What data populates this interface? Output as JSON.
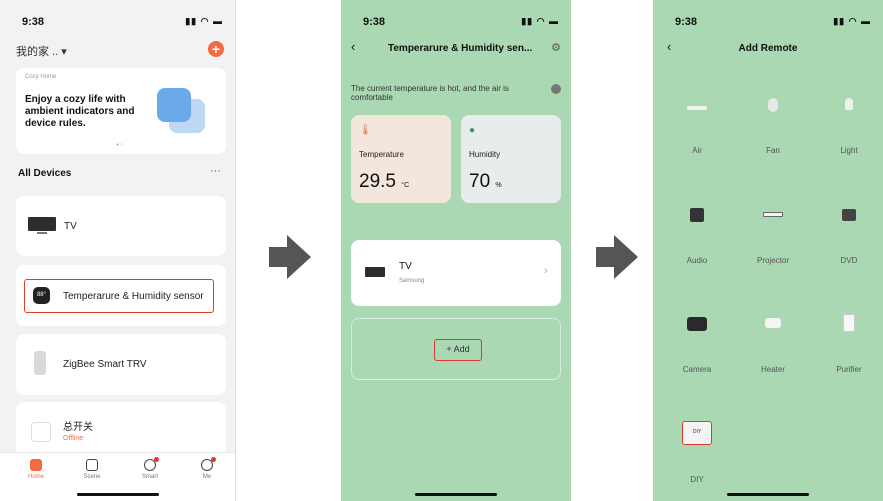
{
  "arrows": {
    "color": "#555555"
  },
  "panel1": {
    "status_time": "9:38",
    "status_icons": "▮▮ ◠ ▬",
    "home_name": "我的家 .. ▾",
    "add_button": "+",
    "banner": {
      "subtitle": "Cozy Home",
      "text": "Enjoy a cozy life with ambient indicators and device rules.",
      "dots": "● ○"
    },
    "section_title": "All Devices",
    "more": "···",
    "devices": [
      {
        "name": "TV"
      },
      {
        "name": "Temperarure & Humidity sensor"
      },
      {
        "name": "ZigBee Smart TRV"
      },
      {
        "name": "总开关",
        "status": "Offline"
      }
    ],
    "sensor_icon_text": "88°",
    "tabs": [
      {
        "label": "Home"
      },
      {
        "label": "Scene"
      },
      {
        "label": "Smart"
      },
      {
        "label": "Me"
      }
    ],
    "accent": "#f36b3f"
  },
  "panel2": {
    "status_time": "9:38",
    "status_icons": "▮▮ ◠ ▬",
    "back": "‹",
    "title": "Temperarure & Humidity sen...",
    "gear": "⚙",
    "comfort_text": "The current temperature is hot, and the air is comfortable",
    "temperature": {
      "label": "Temperature",
      "value": "29.5",
      "unit": "°C"
    },
    "humidity": {
      "label": "Humidity",
      "value": "70",
      "unit": "%"
    },
    "tv_card": {
      "name": "TV",
      "brand": "Samsung",
      "chevron": "›"
    },
    "add_label": "+ Add",
    "background": "#a9d8b2"
  },
  "panel3": {
    "status_time": "9:38",
    "status_icons": "▮▮ ◠ ▬",
    "back": "‹",
    "title": "Add Remote",
    "remotes": [
      {
        "name": "Air",
        "icon": "air-conditioner-icon"
      },
      {
        "name": "Fan",
        "icon": "fan-icon"
      },
      {
        "name": "Light",
        "icon": "light-bulb-icon"
      },
      {
        "name": "Audio",
        "icon": "speaker-icon"
      },
      {
        "name": "Projector",
        "icon": "projector-icon"
      },
      {
        "name": "DVD",
        "icon": "dvd-player-icon"
      },
      {
        "name": "Camera",
        "icon": "camera-icon"
      },
      {
        "name": "Heater",
        "icon": "heater-icon"
      },
      {
        "name": "Purifier",
        "icon": "air-purifier-icon"
      },
      {
        "name": "DIY",
        "icon": "diy-icon"
      }
    ],
    "diy_icon_text": "DIY"
  }
}
